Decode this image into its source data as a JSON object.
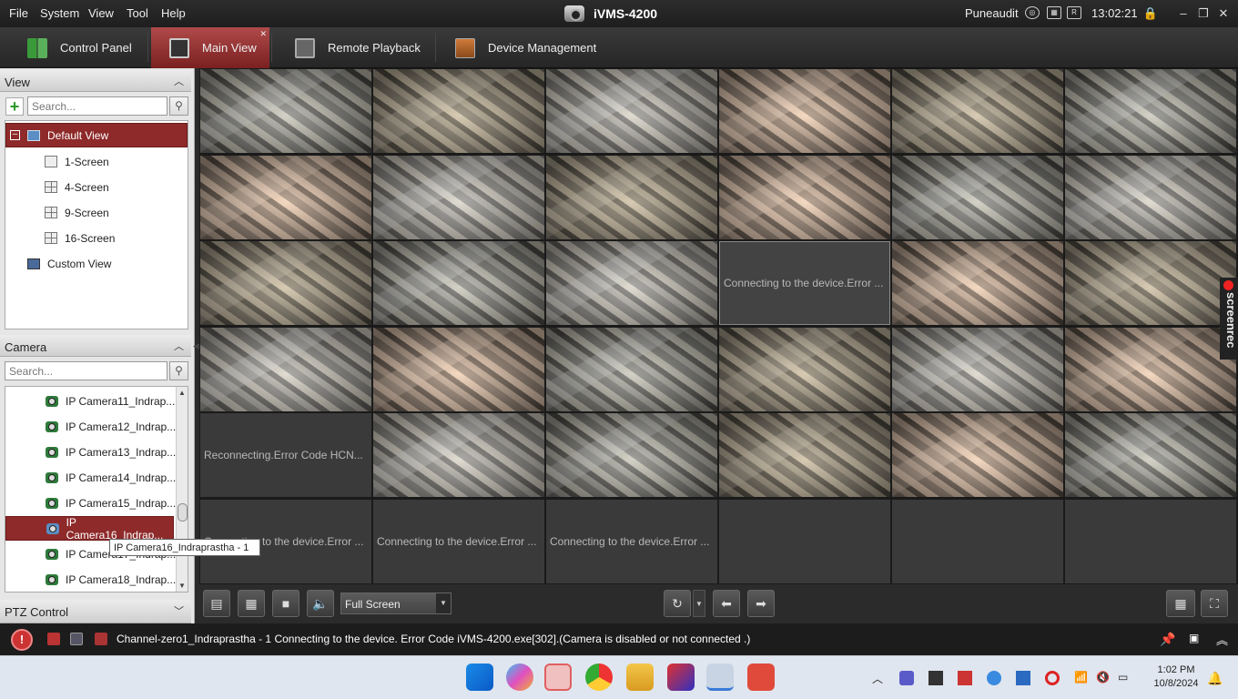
{
  "menu": {
    "items": [
      "File",
      "System",
      "View",
      "Tool",
      "Help"
    ],
    "app_title": "iVMS-4200",
    "user": "Puneaudit",
    "time": "13:02:21"
  },
  "tabs": [
    {
      "label": "Control Panel",
      "active": false
    },
    {
      "label": "Main View",
      "active": true
    },
    {
      "label": "Remote Playback",
      "active": false
    },
    {
      "label": "Device Management",
      "active": false
    }
  ],
  "view_panel": {
    "title": "View",
    "search_placeholder": "Search...",
    "default_view": "Default View",
    "items": [
      "1-Screen",
      "4-Screen",
      "9-Screen",
      "16-Screen"
    ],
    "custom_view": "Custom View"
  },
  "camera_panel": {
    "title": "Camera",
    "search_placeholder": "Search...",
    "cameras": [
      "IP Camera11_Indrap...",
      "IP Camera12_Indrap...",
      "IP Camera13_Indrap...",
      "IP Camera14_Indrap...",
      "IP Camera15_Indrap...",
      "IP Camera16_Indrap...",
      "IP Camera17_Indrap...",
      "IP Camera18_Indrap..."
    ],
    "selected_index": 5,
    "tooltip": "IP Camera16_Indraprastha - 1"
  },
  "ptz_panel": {
    "title": "PTZ Control"
  },
  "grid": {
    "messages": {
      "connect_error": "Connecting to the device.Error ...",
      "reconnect_error": "Reconnecting.Error Code HCN..."
    }
  },
  "toolbar": {
    "screen_mode": "Full Screen"
  },
  "status": {
    "message": "Channel-zero1_Indraprastha - 1 Connecting to the device. Error Code iVMS-4200.exe[302].(Camera is disabled or not connected .)"
  },
  "watermark": {
    "text": "screenrec"
  },
  "taskbar": {
    "time": "1:02 PM",
    "date": "10/8/2024"
  },
  "colors": {
    "accent": "#8e2a2a",
    "tab_active": "#a33a3a",
    "alarm": "#cc3333"
  }
}
